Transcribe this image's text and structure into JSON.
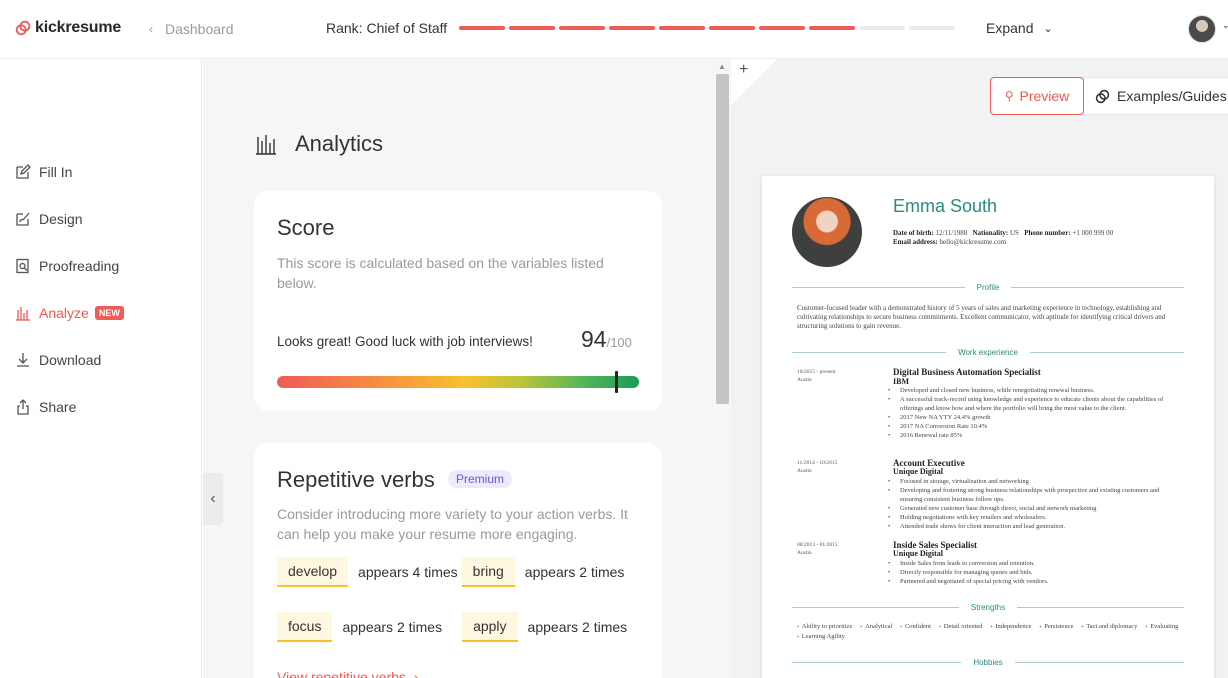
{
  "brand": {
    "name": "kickresume",
    "accent": "#ef5b56",
    "resume_accent": "#2b8c7c"
  },
  "topbar": {
    "back_label": "Dashboard",
    "rank_label": "Rank: Chief of Staff",
    "rank_progress": 0.8,
    "rank_segments_total": 10,
    "rank_segments_filled": 8,
    "expand_label": "Expand"
  },
  "sidebar": {
    "items": [
      {
        "label": "Fill In",
        "icon": "pencil-square-icon"
      },
      {
        "label": "Design",
        "icon": "brush-icon"
      },
      {
        "label": "Proofreading",
        "icon": "document-search-icon"
      },
      {
        "label": "Analyze",
        "icon": "bar-chart-icon",
        "badge": "NEW",
        "active": true
      },
      {
        "label": "Download",
        "icon": "download-icon"
      },
      {
        "label": "Share",
        "icon": "share-icon"
      }
    ]
  },
  "analytics": {
    "title": "Analytics",
    "score": {
      "title": "Score",
      "description": "This score is calculated based on the variables listed below.",
      "message": "Looks great! Good luck with job interviews!",
      "value": "94",
      "max": "/100",
      "fraction": 0.94
    },
    "verbs": {
      "title": "Repetitive verbs",
      "badge": "Premium",
      "description": "Consider introducing more variety to your action verbs. It can help you make your resume more engaging.",
      "items": [
        {
          "verb": "develop",
          "count": "appears 4 times"
        },
        {
          "verb": "bring",
          "count": "appears 2 times"
        },
        {
          "verb": "focus",
          "count": "appears 2 times"
        },
        {
          "verb": "apply",
          "count": "appears 2 times"
        }
      ],
      "link": "View repetitive verbs"
    }
  },
  "preview": {
    "preview_label": "Preview",
    "guides_label": "Examples/Guides",
    "plus": "+"
  },
  "resume": {
    "name": "Emma South",
    "meta_line1_dob_label": "Date of birth:",
    "meta_line1_dob": "12/11/1988",
    "meta_line1_nat_label": "Nationality:",
    "meta_line1_nat": "US",
    "meta_line1_phone_label": "Phone number:",
    "meta_line1_phone": "+1 000 999 00",
    "meta_line2_email_label": "Email address:",
    "meta_line2_email": "hello@kickresume.com",
    "profile_title": "Profile",
    "profile_text": "Customer-focused leader with a demonstrated history of 5 years of sales and marketing experience in technology, establishing and cultivating relationships to secure business commitments. Excellent communicator, with aptitude for identifying critical drivers and structuring solutions to gain revenue.",
    "work_title": "Work experience",
    "jobs": [
      {
        "date": "10/2015 - present",
        "location": "Austin",
        "title": "Digital Business Automation Specialist",
        "company": "IBM",
        "bullets": [
          "Developed and closed new business, while renegotiating renewal business.",
          "A successful track-record using knowledge and experience to educate clients about the capabilities of offerings and know how and where the portfolio will bring the most value to the client.",
          "2017 New NA YTY 24.4% growth",
          "2017 NA Conversion Rate 10.4%",
          "2016 Renewal rate 85%"
        ]
      },
      {
        "date": "11/2014 - 10/2015",
        "location": "Austin",
        "title": "Account Executive",
        "company": "Unique Digital",
        "bullets": [
          "Focused in storage, virtualization and networking",
          "Developing and fostering strong business relationships with prospective and existing customers and ensuring consistent business follow ups.",
          "Generated new customer base through direct, social and network marketing",
          "Holding negotiations with key retailers and wholesalers.",
          "Attended trade shows for client interaction and lead generation."
        ]
      },
      {
        "date": "08/2013 - 01/2015",
        "location": "Austin",
        "title": "Inside Sales Specialist",
        "company": "Unique Digital",
        "bullets": [
          "Inside Sales from leads to conversion and retention.",
          "Directly responsible for managing quotes and bids.",
          "Partnered and negotiated of special pricing with vendors."
        ]
      }
    ],
    "strengths_title": "Strengths",
    "strengths": [
      "Ability to prioritize",
      "Analytical",
      "Confident",
      "Detail oriented",
      "Independence",
      "Persistence",
      "Tact and diplomacy",
      "Evaluating",
      "Learning Agility"
    ],
    "hobbies_title": "Hobbies"
  }
}
